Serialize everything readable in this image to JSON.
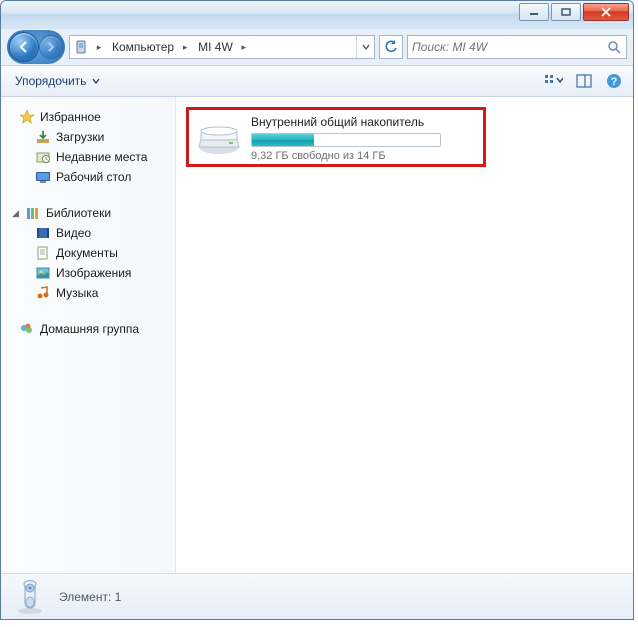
{
  "titlebar": {},
  "breadcrumb": {
    "seg1": "Компьютер",
    "seg2": "MI 4W"
  },
  "search": {
    "placeholder": "Поиск: MI 4W"
  },
  "toolbar": {
    "organize": "Упорядочить"
  },
  "sidebar": {
    "favorites": {
      "label": "Избранное",
      "items": [
        "Загрузки",
        "Недавние места",
        "Рабочий стол"
      ]
    },
    "libraries": {
      "label": "Библиотеки",
      "items": [
        "Видео",
        "Документы",
        "Изображения",
        "Музыка"
      ]
    },
    "homegroup": {
      "label": "Домашняя группа"
    }
  },
  "drive": {
    "title": "Внутренний общий накопитель",
    "free_text": "9,32 ГБ свободно из 14 ГБ",
    "used_percent": 33
  },
  "status": {
    "text": "Элемент: 1"
  },
  "colors": {
    "highlight_border": "#d31a1a"
  }
}
